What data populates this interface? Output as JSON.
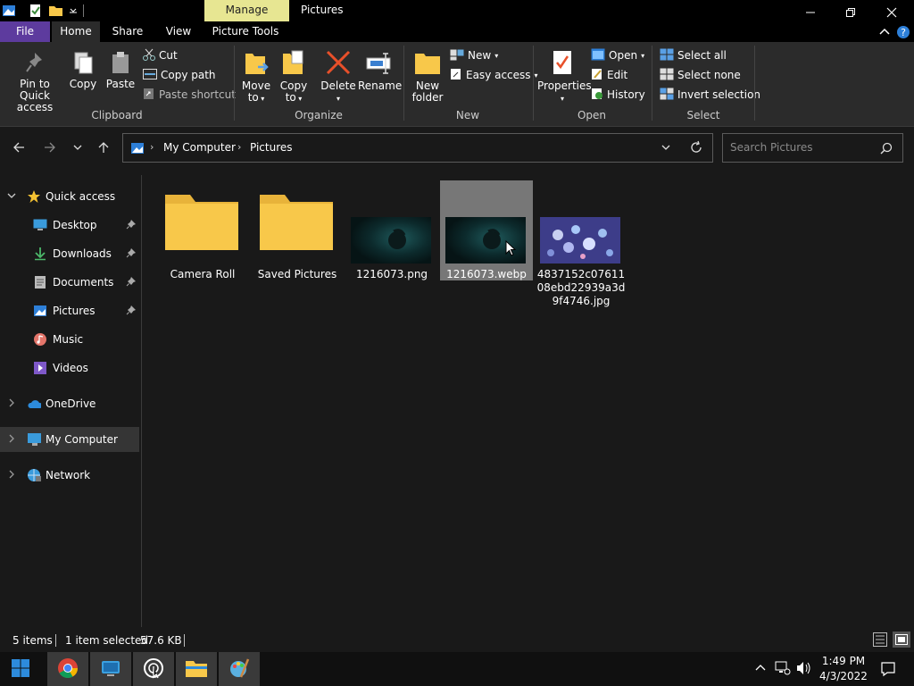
{
  "titlebar": {
    "manage_tab": "Manage",
    "title": "Pictures",
    "icons": [
      "folder-app-icon",
      "properties-icon",
      "new-folder-icon",
      "dropdown-icon"
    ],
    "window_controls": [
      "minimize-icon",
      "restore-icon",
      "close-icon"
    ]
  },
  "tabs": {
    "file": "File",
    "home": "Home",
    "share": "Share",
    "view": "View",
    "picture_tools": "Picture Tools"
  },
  "ribbon": {
    "clipboard": {
      "pin_label": "Pin to Quick access",
      "pin_line1": "Pin to Quick",
      "pin_line2": "access",
      "copy": "Copy",
      "paste": "Paste",
      "cut": "Cut",
      "copy_path": "Copy path",
      "paste_shortcut": "Paste shortcut",
      "group": "Clipboard"
    },
    "organize": {
      "move_line1": "Move",
      "move_line2": "to",
      "copy_line1": "Copy",
      "copy_line2": "to",
      "delete": "Delete",
      "rename": "Rename",
      "group": "Organize"
    },
    "new": {
      "new_folder_line1": "New",
      "new_folder_line2": "folder",
      "new_item": "New",
      "easy_access": "Easy access",
      "group": "New"
    },
    "open": {
      "properties": "Properties",
      "open": "Open",
      "edit": "Edit",
      "history": "History",
      "group": "Open"
    },
    "select": {
      "select_all": "Select all",
      "select_none": "Select none",
      "invert_selection": "Invert selection",
      "group": "Select"
    }
  },
  "address": {
    "crumb1": "My Computer",
    "crumb2": "Pictures",
    "search_placeholder": "Search Pictures"
  },
  "sidebar": {
    "items": [
      {
        "label": "Quick access"
      },
      {
        "label": "Desktop"
      },
      {
        "label": "Downloads"
      },
      {
        "label": "Documents"
      },
      {
        "label": "Pictures"
      },
      {
        "label": "Music"
      },
      {
        "label": "Videos"
      },
      {
        "label": "OneDrive"
      },
      {
        "label": "My Computer"
      },
      {
        "label": "Network"
      }
    ]
  },
  "files": [
    {
      "name": "Camera Roll",
      "kind": "folder"
    },
    {
      "name": "Saved Pictures",
      "kind": "folder"
    },
    {
      "name": "1216073.png",
      "kind": "image"
    },
    {
      "name": "1216073.webp",
      "kind": "image",
      "selected": true
    },
    {
      "name": "4837152c0761108ebd22939a3d9f4746.jpg",
      "kind": "image"
    }
  ],
  "status": {
    "items": "5 items",
    "selected": "1 item selected",
    "size": "57.6 KB"
  },
  "taskbar": {
    "time": "1:49 PM",
    "date": "4/3/2022",
    "apps": [
      "windows-start-icon",
      "chrome-icon",
      "remote-desktop-icon",
      "cursor-app-icon",
      "file-explorer-icon",
      "paint-icon"
    ]
  },
  "colors": {
    "file_tab": "#5d3b9e",
    "manage_tab": "#e7e692",
    "folder": "#f8c84a",
    "selection": "#777777",
    "background": "#191919"
  }
}
